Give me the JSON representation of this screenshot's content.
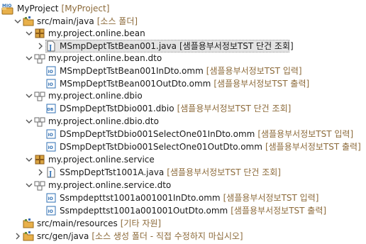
{
  "tree": {
    "project": {
      "label": "MyProject",
      "decoration": "[MyProject]"
    },
    "src_main_java": {
      "label": "src/main/java",
      "decoration": "[소스 폴더]"
    },
    "pkg_bean": {
      "label": "my.project.online.bean"
    },
    "file_bean": {
      "label": "MSmpDeptTstBean001.java",
      "decoration": "[샘플용부서정보TST 단건 조회]"
    },
    "pkg_bean_dto": {
      "label": "my.project.online.bean.dto"
    },
    "file_bean_in": {
      "label": "MSmpDeptTstBean001InDto.omm",
      "decoration": "[샘플용부서정보TST 입력]"
    },
    "file_bean_out": {
      "label": "MSmpDeptTstBean001OutDto.omm",
      "decoration": "[샘플용부서정보TST 출력]"
    },
    "pkg_dbio": {
      "label": "my.project.online.dbio"
    },
    "file_dbio": {
      "label": "DSmpDeptTstDbio001.dbio",
      "decoration": "[샘플용부서정보TST 단건 조회]"
    },
    "pkg_dbio_dto": {
      "label": "my.project.online.dbio.dto"
    },
    "file_dbio_in": {
      "label": "DSmpDeptTstDbio001SelectOne01InDto.omm",
      "decoration": "[샘플용부서정보TST 입력]"
    },
    "file_dbio_out": {
      "label": "DSmpDeptTstDbio001SelectOne01OutDto.omm",
      "decoration": "[샘플용부서정보TST 출력]"
    },
    "pkg_service": {
      "label": "my.project.online.service"
    },
    "file_service": {
      "label": "SSmpDeptTst1001A.java",
      "decoration": "[샘플용부서정보TST 단건 조회]"
    },
    "pkg_service_dto": {
      "label": "my.project.online.service.dto"
    },
    "file_service_in": {
      "label": "Ssmpdepttst1001a001001InDto.omm",
      "decoration": "[샘플용부서정보TST 입력]"
    },
    "file_service_out": {
      "label": "Ssmpdepttst1001a001001OutDto.omm",
      "decoration": "[샘플용부서정보TST 출력]"
    },
    "src_main_resources": {
      "label": "src/main/resources",
      "decoration": "[기타 자원]"
    },
    "src_gen_java": {
      "label": "src/gen/java",
      "decoration": "[소스 생성 폴더 - 직접 수정하지 마십시오]"
    }
  },
  "icons": {
    "project": "project-icon",
    "source_folder": "source-folder-icon",
    "package": "package-icon",
    "java_file": "java-file-icon",
    "omm_file": "omm-file-icon",
    "dbio_file": "dbio-file-icon"
  },
  "colors": {
    "decoration": "#8c6a3a",
    "selection": "#e4e4e4",
    "folder": "#d9a441",
    "package": "#b07a2a",
    "file_blue": "#2f6fb3"
  }
}
